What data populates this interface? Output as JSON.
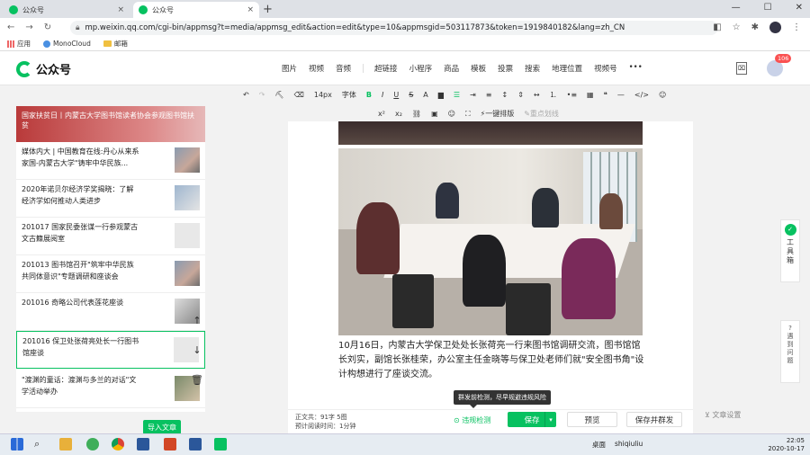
{
  "browser": {
    "tabs": [
      {
        "title": "公众号",
        "active": false
      },
      {
        "title": "公众号",
        "active": true
      }
    ],
    "new_tab": "+",
    "url": "mp.weixin.qq.com/cgi-bin/appmsg?t=media/appmsg_edit&action=edit&type=10&appmsgid=503117873&token=1919840182&lang=zh_CN",
    "bookmarks": [
      "应用",
      "MonoCloud",
      "邮箱"
    ]
  },
  "header": {
    "logo": "公众号",
    "nav_groups": [
      [
        "图片",
        "视频",
        "音频"
      ],
      [
        "超链接",
        "小程序",
        "商品",
        "模板",
        "投票",
        "搜索",
        "地理位置",
        "视频号",
        "•••"
      ]
    ],
    "badge": "106"
  },
  "toolbar": {
    "font_size": "14px",
    "font": "字体",
    "one_click_layout": "一键排版",
    "key_highlight": "重点划线"
  },
  "sidebar": {
    "cover_text": "国家扶贫日丨内蒙古大学图书馆读者协会参观图书馆扶贫",
    "items": [
      {
        "title": "媒体内大 | 中国教育在线:丹心从来系家国-内蒙古大学\"铸牢中华民族..."
      },
      {
        "title": "2020年诺贝尔经济学奖揭晓：了解经济学如何推动人类进步"
      },
      {
        "title": "201017 国家民委张谋一行参观蒙古文古籍展阅室"
      },
      {
        "title": "201013 图书馆召开\"筑牢中华民族共同体意识\"专题调研和座谈会"
      },
      {
        "title": "201016 奇略公司代表莲花座谈"
      },
      {
        "title": "201016 保卫处张荷亮处长一行图书馆座谈"
      },
      {
        "title": "\"渡渊的童话：渡渊与多兰的对话\"文学活动举办"
      }
    ],
    "import_button": "导入文章",
    "up_arrow": "↑",
    "down_arrow": "↓"
  },
  "editor": {
    "paragraph": "10月16日，内蒙古大学保卫处处长张荷亮一行来图书馆调研交流，图书馆馆长刘实，副馆长张桂荣，办公室主任金晓等与保卫处老师们就\"安全图书角\"设计构想进行了座谈交流。"
  },
  "footer": {
    "word_count_label": "正文共：",
    "word_count": "91字 5图",
    "read_time_label": "预计阅读时间：",
    "read_time": "1分钟",
    "detect": "违规检测",
    "save": "保存",
    "preview": "预览",
    "save_send": "保存并群发",
    "tooltip": "群发前检测，尽早规避违规风险",
    "settings": "文章设置"
  },
  "side_tools": {
    "tools_label": "工具箱",
    "help_label": "遇到问题"
  },
  "taskbar": {
    "desktop": "桌面",
    "user": "shiqiuliu",
    "time": "22:05",
    "date": "2020-10-17"
  },
  "colors": {
    "accent": "#07c160",
    "badge": "#fa5151"
  }
}
